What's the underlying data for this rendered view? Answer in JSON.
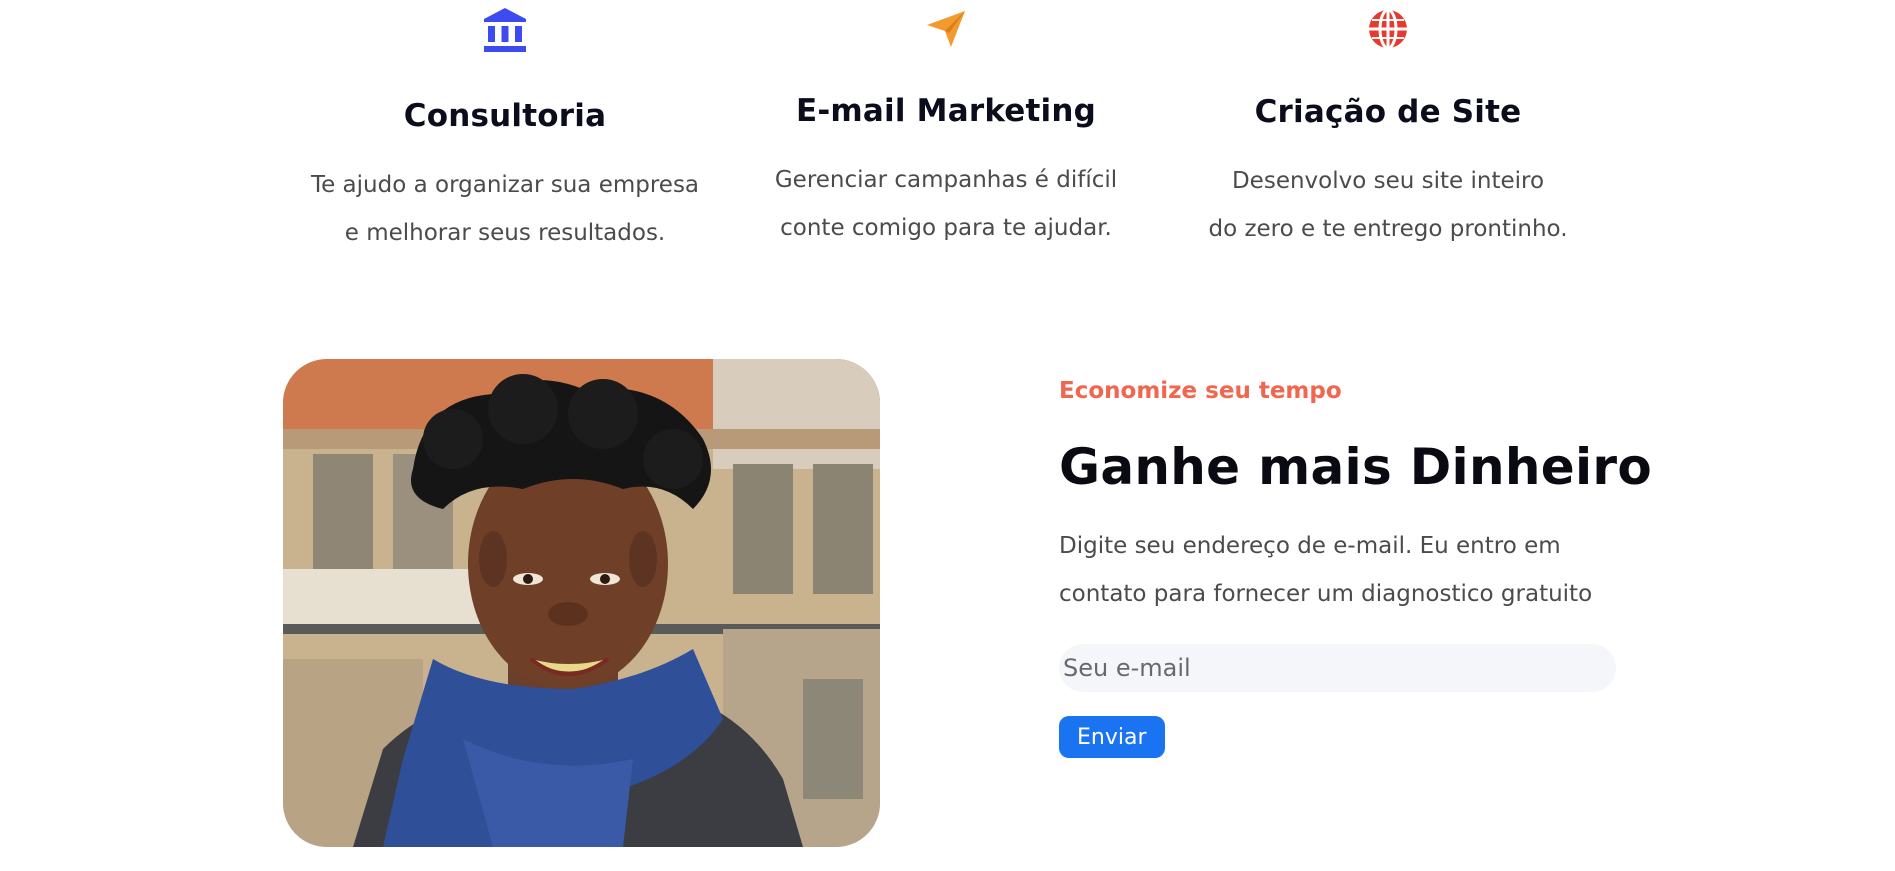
{
  "services": [
    {
      "icon": "bank-icon",
      "title": "Consultoria",
      "line1": "Te ajudo a organizar sua empresa",
      "line2": "e melhorar seus resultados.",
      "color": "#3b4bf0"
    },
    {
      "icon": "paper-plane-icon",
      "title": "E-mail Marketing",
      "line1": "Gerenciar campanhas é difícil",
      "line2": "conte comigo para te ajudar.",
      "color": "#f39a2f"
    },
    {
      "icon": "globe-icon",
      "title": "Criação de Site",
      "line1": "Desenvolvo seu site inteiro",
      "line2": "do zero e te entrego prontinho.",
      "color": "#e83a2c"
    }
  ],
  "newsletter": {
    "eyebrow": "Economize seu tempo",
    "title": "Ganhe mais Dinheiro",
    "desc_line1": "Digite seu endereço de e-mail. Eu entro em",
    "desc_line2": "contato para fornecer um diagnostico gratuito",
    "email_placeholder": "Seu e-mail",
    "email_value": "",
    "submit_label": "Enviar",
    "accent_color": "#f0664f",
    "button_color": "#1a73f0"
  },
  "photo": {
    "icon": "portrait-photo"
  }
}
